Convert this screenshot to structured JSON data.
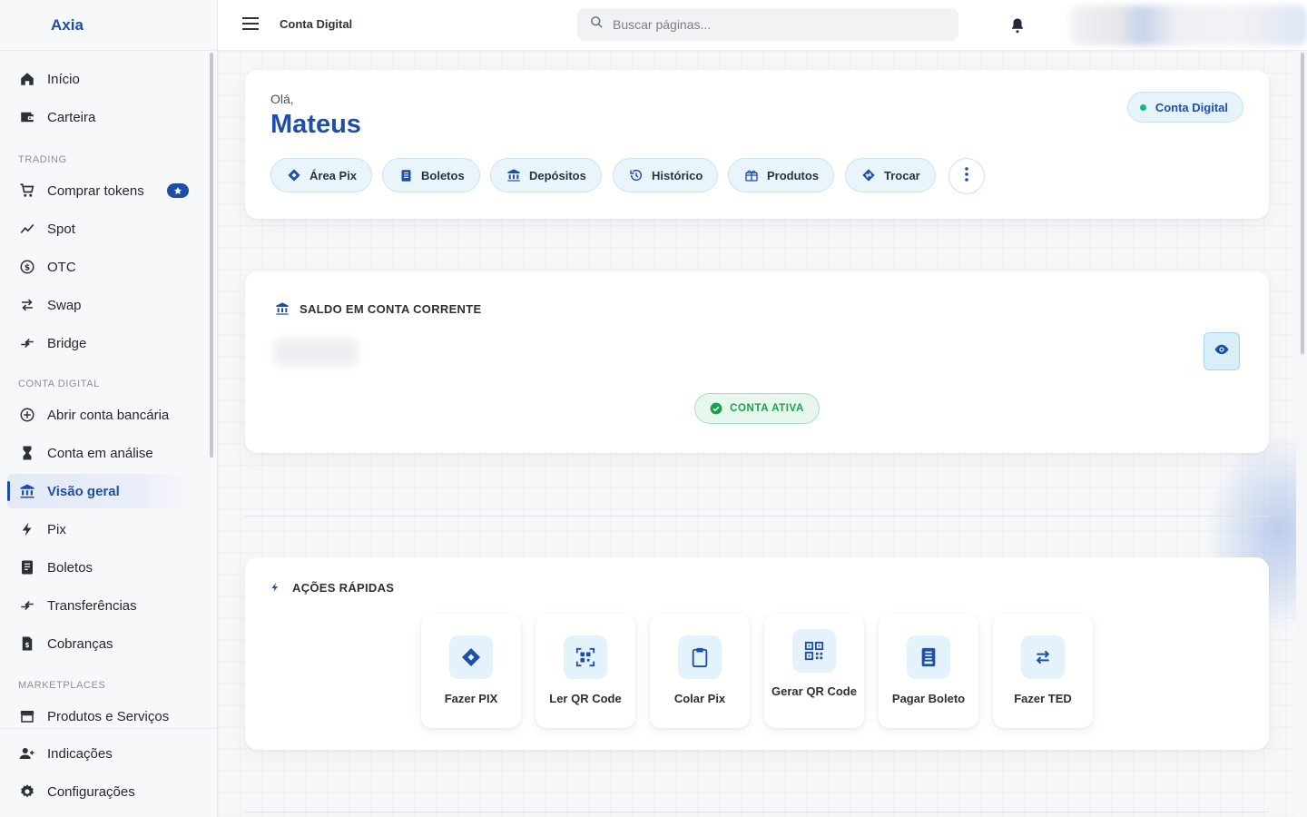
{
  "brand": "Axia",
  "header": {
    "title": "Conta Digital",
    "search_placeholder": "Buscar páginas..."
  },
  "sidebar": {
    "items_top": [
      {
        "label": "Início",
        "icon": "home-icon"
      },
      {
        "label": "Carteira",
        "icon": "wallet-icon"
      }
    ],
    "sections": [
      {
        "title": "TRADING",
        "items": [
          {
            "label": "Comprar tokens",
            "icon": "cart-icon",
            "badge": "star-badge"
          },
          {
            "label": "Spot",
            "icon": "trend-icon"
          },
          {
            "label": "OTC",
            "icon": "currency-exchange-icon"
          },
          {
            "label": "Swap",
            "icon": "swap-arrows-icon"
          },
          {
            "label": "Bridge",
            "icon": "bridge-icon"
          }
        ]
      },
      {
        "title": "CONTA DIGITAL",
        "items": [
          {
            "label": "Abrir conta bancária",
            "icon": "plus-circle-icon"
          },
          {
            "label": "Conta em análise",
            "icon": "hourglass-icon"
          },
          {
            "label": "Visão geral",
            "icon": "bank-icon",
            "active": true
          },
          {
            "label": "Pix",
            "icon": "bolt-icon"
          },
          {
            "label": "Boletos",
            "icon": "receipt-icon"
          },
          {
            "label": "Transferências",
            "icon": "transfer-icon"
          },
          {
            "label": "Cobranças",
            "icon": "invoice-icon"
          }
        ]
      },
      {
        "title": "MARKETPLACES",
        "items": [
          {
            "label": "Produtos e Serviços",
            "icon": "store-icon"
          }
        ]
      }
    ],
    "items_bottom": [
      {
        "label": "Indicações",
        "icon": "user-add-icon"
      },
      {
        "label": "Configurações",
        "icon": "gear-icon"
      }
    ]
  },
  "welcome": {
    "greeting": "Olá,",
    "name": "Mateus",
    "account_badge": "Conta Digital",
    "chips": [
      "Área Pix",
      "Boletos",
      "Depósitos",
      "Histórico",
      "Produtos",
      "Trocar"
    ]
  },
  "balance": {
    "title": "SALDO EM CONTA CORRENTE",
    "status": "CONTA ATIVA"
  },
  "quick_actions": {
    "title": "AÇÕES RÁPIDAS",
    "items": [
      "Fazer PIX",
      "Ler QR Code",
      "Colar Pix",
      "Gerar QR Code",
      "Pagar Boleto",
      "Fazer TED"
    ]
  },
  "colors": {
    "accent": "#1e4fa8",
    "success": "#16a34a"
  }
}
